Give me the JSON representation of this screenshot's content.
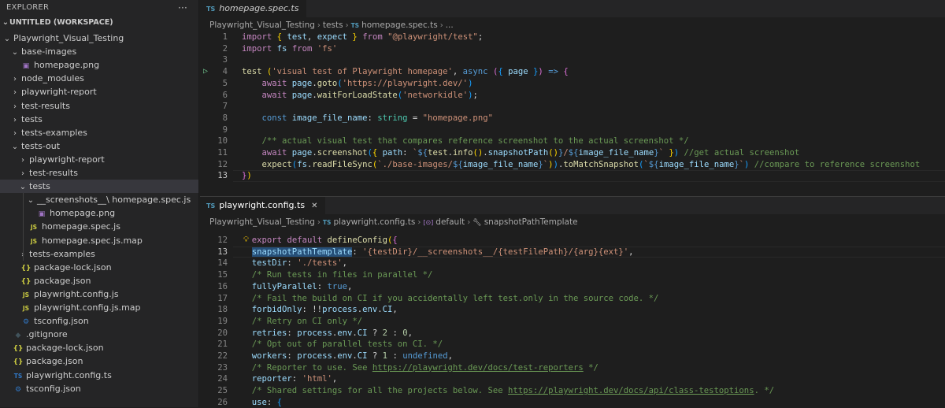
{
  "explorer": {
    "title": "EXPLORER",
    "more": "···",
    "workspace": "UNTITLED (WORKSPACE)",
    "tree": [
      {
        "label": "Playwright_Visual_Testing",
        "chev": "⌄",
        "icon": "",
        "indent": 0,
        "kind": "folder"
      },
      {
        "label": "base-images",
        "chev": "⌄",
        "icon": "",
        "indent": 1,
        "kind": "folder"
      },
      {
        "label": "homepage.png",
        "chev": "",
        "icon": "▣",
        "indent": 2,
        "kind": "img"
      },
      {
        "label": "node_modules",
        "chev": "›",
        "icon": "",
        "indent": 1,
        "kind": "folder"
      },
      {
        "label": "playwright-report",
        "chev": "›",
        "icon": "",
        "indent": 1,
        "kind": "folder"
      },
      {
        "label": "test-results",
        "chev": "›",
        "icon": "",
        "indent": 1,
        "kind": "folder"
      },
      {
        "label": "tests",
        "chev": "›",
        "icon": "",
        "indent": 1,
        "kind": "folder"
      },
      {
        "label": "tests-examples",
        "chev": "›",
        "icon": "",
        "indent": 1,
        "kind": "folder"
      },
      {
        "label": "tests-out",
        "chev": "⌄",
        "icon": "",
        "indent": 1,
        "kind": "folder"
      },
      {
        "label": "playwright-report",
        "chev": "›",
        "icon": "",
        "indent": 2,
        "kind": "folder"
      },
      {
        "label": "test-results",
        "chev": "›",
        "icon": "",
        "indent": 2,
        "kind": "folder"
      },
      {
        "label": "tests",
        "chev": "⌄",
        "icon": "",
        "indent": 2,
        "kind": "folder",
        "selected": true
      },
      {
        "label": "__screenshots__\\ homepage.spec.js",
        "chev": "⌄",
        "icon": "",
        "indent": 3,
        "kind": "folder"
      },
      {
        "label": "homepage.png",
        "chev": "",
        "icon": "▣",
        "indent": 4,
        "kind": "img"
      },
      {
        "label": "homepage.spec.js",
        "chev": "",
        "icon": "JS",
        "indent": 3,
        "kind": "js"
      },
      {
        "label": "homepage.spec.js.map",
        "chev": "",
        "icon": "JS",
        "indent": 3,
        "kind": "js"
      },
      {
        "label": "tests-examples",
        "chev": "›",
        "icon": "",
        "indent": 2,
        "kind": "folder"
      },
      {
        "label": "package-lock.json",
        "chev": "",
        "icon": "{}",
        "indent": 2,
        "kind": "json"
      },
      {
        "label": "package.json",
        "chev": "",
        "icon": "{}",
        "indent": 2,
        "kind": "json"
      },
      {
        "label": "playwright.config.js",
        "chev": "",
        "icon": "JS",
        "indent": 2,
        "kind": "js"
      },
      {
        "label": "playwright.config.js.map",
        "chev": "",
        "icon": "JS",
        "indent": 2,
        "kind": "js"
      },
      {
        "label": "tsconfig.json",
        "chev": "",
        "icon": "⚙",
        "indent": 2,
        "kind": "tsconf"
      },
      {
        "label": ".gitignore",
        "chev": "",
        "icon": "◆",
        "indent": 1,
        "kind": "git"
      },
      {
        "label": "package-lock.json",
        "chev": "",
        "icon": "{}",
        "indent": 1,
        "kind": "json"
      },
      {
        "label": "package.json",
        "chev": "",
        "icon": "{}",
        "indent": 1,
        "kind": "json"
      },
      {
        "label": "playwright.config.ts",
        "chev": "",
        "icon": "TS",
        "indent": 1,
        "kind": "ts"
      },
      {
        "label": "tsconfig.json",
        "chev": "",
        "icon": "⚙",
        "indent": 1,
        "kind": "tsconf"
      }
    ]
  },
  "editor1": {
    "tab": {
      "icon": "TS",
      "label": "homepage.spec.ts",
      "close": ""
    },
    "breadcrumb": [
      "Playwright_Visual_Testing",
      "tests",
      "homepage.spec.ts",
      "..."
    ],
    "lines": [
      {
        "n": "1",
        "html": "<span class='kw'>import</span> <span class='br1'>{</span> <span class='var'>test</span>, <span class='var'>expect</span> <span class='br1'>}</span> <span class='kw'>from</span> <span class='str'>\"@playwright/test\"</span>;"
      },
      {
        "n": "2",
        "html": "<span class='kw'>import</span> <span class='var'>fs</span> <span class='kw'>from</span> <span class='str'>'fs'</span>"
      },
      {
        "n": "3",
        "html": ""
      },
      {
        "n": "4",
        "html": "<span class='fn'>test</span> <span class='br1'>(</span><span class='str'>'visual test of Playwright homepage'</span>, <span class='kwb'>async</span> <span class='br2'>(</span><span class='br3'>{</span> <span class='var'>page</span> <span class='br3'>}</span><span class='br2'>)</span> <span class='kwb'>=&gt;</span> <span class='br2'>{</span>",
        "run": true
      },
      {
        "n": "5",
        "html": "    <span class='kw'>await</span> <span class='var'>page</span>.<span class='fn'>goto</span><span class='br3'>(</span><span class='str'>'https://playwright.dev/'</span><span class='br3'>)</span>"
      },
      {
        "n": "6",
        "html": "    <span class='kw'>await</span> <span class='var'>page</span>.<span class='fn'>waitForLoadState</span><span class='br3'>(</span><span class='str'>'networkidle'</span><span class='br3'>)</span>;"
      },
      {
        "n": "7",
        "html": ""
      },
      {
        "n": "8",
        "html": "    <span class='kwb'>const</span> <span class='var'>image_file_name</span>: <span class='typ'>string</span> = <span class='str'>\"homepage.png\"</span>"
      },
      {
        "n": "9",
        "html": ""
      },
      {
        "n": "10",
        "html": "    <span class='cmt'>/** actual visual test that compares reference screenshot to the actual screenshot */</span>"
      },
      {
        "n": "11",
        "html": "    <span class='kw'>await</span> <span class='var'>page</span>.<span class='fn'>screenshot</span><span class='br3'>(</span><span class='br1'>{</span> <span class='var'>path</span>: <span class='str'>`</span><span class='tplp'>${</span><span class='fn'>test</span>.<span class='fn'>info</span><span class='br1'>()</span>.<span class='var'>snapshotPath</span><span class='br1'>()</span><span class='tplp'>}</span><span class='str'>/</span><span class='tplp'>${</span><span class='var'>image_file_name</span><span class='tplp'>}</span><span class='str'>`</span> <span class='br1'>}</span><span class='br3'>)</span> <span class='cmt'>//get actual screenshot</span>"
      },
      {
        "n": "12",
        "html": "    <span class='fn'>expect</span><span class='br3'>(</span><span class='var'>fs</span>.<span class='fn'>readFileSync</span><span class='br1'>(</span><span class='str'>`./base-images/</span><span class='tplp'>${</span><span class='var'>image_file_name</span><span class='tplp'>}</span><span class='str'>`</span><span class='br1'>)</span><span class='br3'>)</span>.<span class='fn'>toMatchSnapshot</span><span class='br3'>(</span><span class='str'>`</span><span class='tplp'>${</span><span class='var'>image_file_name</span><span class='tplp'>}</span><span class='str'>`</span><span class='br3'>)</span> <span class='cmt'>//compare to reference screenshot</span>"
      },
      {
        "n": "13",
        "html": "<span class='br2'>}</span><span class='br1'>)</span>",
        "current": true
      }
    ]
  },
  "editor2": {
    "tab": {
      "icon": "TS",
      "label": "playwright.config.ts",
      "close": "✕"
    },
    "breadcrumb": [
      "Playwright_Visual_Testing",
      "playwright.config.ts",
      "default",
      "snapshotPathTemplate"
    ],
    "lines": [
      {
        "n": "12",
        "html": "  <span class='kw'>export</span> <span class='kw'>default</span> <span class='fn'>defineConfig</span><span class='br1'>(</span><span class='br2'>{</span>",
        "bulb": true
      },
      {
        "n": "13",
        "html": "  <span class='var hl'>snapshotPathTemplate</span>: <span class='str'>'{testDir}/__screenshots__/{testFilePath}/{arg}{ext}'</span>,",
        "current": true
      },
      {
        "n": "14",
        "html": "  <span class='var'>testDir</span>: <span class='str'>'./tests'</span>,"
      },
      {
        "n": "15",
        "html": "  <span class='cmt'>/* Run tests in files in parallel */</span>"
      },
      {
        "n": "16",
        "html": "  <span class='var'>fullyParallel</span>: <span class='kwb'>true</span>,"
      },
      {
        "n": "17",
        "html": "  <span class='cmt'>/* Fail the build on CI if you accidentally left test.only in the source code. */</span>"
      },
      {
        "n": "18",
        "html": "  <span class='var'>forbidOnly</span>: !!<span class='var'>process</span>.<span class='var'>env</span>.<span class='var'>CI</span>,"
      },
      {
        "n": "19",
        "html": "  <span class='cmt'>/* Retry on CI only */</span>"
      },
      {
        "n": "20",
        "html": "  <span class='var'>retries</span>: <span class='var'>process</span>.<span class='var'>env</span>.<span class='var'>CI</span> ? <span class='num'>2</span> : <span class='num'>0</span>,"
      },
      {
        "n": "21",
        "html": "  <span class='cmt'>/* Opt out of parallel tests on CI. */</span>"
      },
      {
        "n": "22",
        "html": "  <span class='var'>workers</span>: <span class='var'>process</span>.<span class='var'>env</span>.<span class='var'>CI</span> ? <span class='num'>1</span> : <span class='kwb'>undefined</span>,"
      },
      {
        "n": "23",
        "html": "  <span class='cmt'>/* Reporter to use. See <span class='link'>https://playwright.dev/docs/test-reporters</span> */</span>"
      },
      {
        "n": "24",
        "html": "  <span class='var'>reporter</span>: <span class='str'>'html'</span>,"
      },
      {
        "n": "25",
        "html": "  <span class='cmt'>/* Shared settings for all the projects below. See <span class='link'>https://playwright.dev/docs/api/class-testoptions</span>. */</span>"
      },
      {
        "n": "26",
        "html": "  <span class='var'>use</span>: <span class='br3'>{</span>"
      }
    ]
  }
}
